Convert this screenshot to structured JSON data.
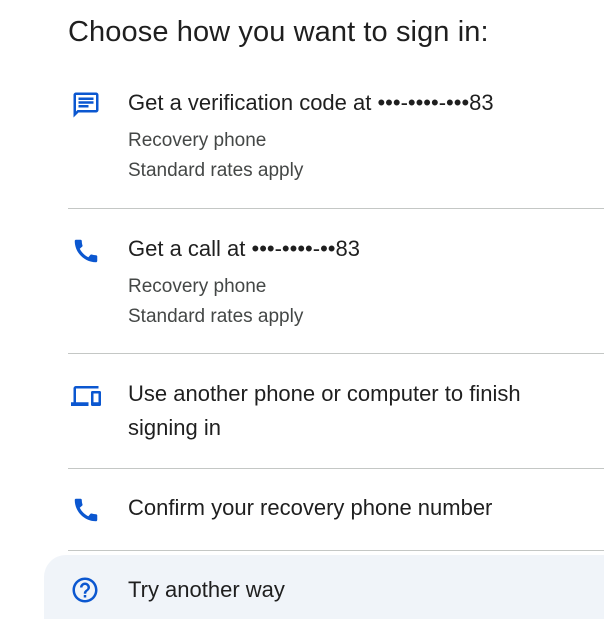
{
  "heading": "Choose how you want to sign in:",
  "options": [
    {
      "label": "Get a verification code at •••-••••-•••83",
      "sub1": "Recovery phone",
      "sub2": "Standard rates apply",
      "icon": "message-icon"
    },
    {
      "label": "Get a call at •••-••••-••83",
      "sub1": "Recovery phone",
      "sub2": "Standard rates apply",
      "icon": "phone-icon"
    },
    {
      "label": "Use another phone or computer to finish signing in",
      "icon": "devices-icon"
    },
    {
      "label": "Confirm your recovery phone number",
      "icon": "phone-icon"
    }
  ],
  "try_another": {
    "label": "Try another way",
    "icon": "help-circle-icon"
  },
  "colors": {
    "accent": "#0b57d0",
    "divider": "#c4c7c5",
    "highlight_bg": "#f0f4f9"
  }
}
